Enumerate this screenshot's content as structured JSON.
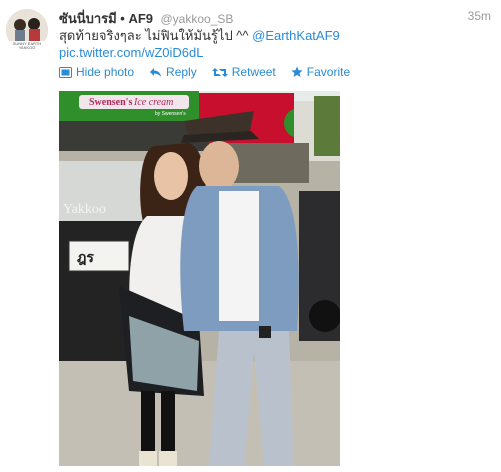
{
  "tweet": {
    "fullname": "ซันนี่บารมี • AF9",
    "username": "@yakkoo_SB",
    "time": "35m",
    "text_main": "สุดท้ายจริงๆละ ไม่ฟินให้มันรู้ไป ^^ ",
    "mention": "@EarthKatAF9",
    "link": "pic.twitter.com/wZ0iD6dL",
    "actions": {
      "hide_photo": "Hide photo",
      "reply": "Reply",
      "retweet": "Retweet",
      "favorite": "Favorite"
    }
  },
  "avatar_text": {
    "line1": "SUNNY EARTH",
    "line2": "YAKKOO"
  },
  "photo_text": {
    "sign_brand": "Swensen's",
    "sign_main": "Ice cream",
    "sign_sub": "by Swensen's",
    "watermark": "Yakkoo",
    "plate": "ฎร"
  },
  "colors": {
    "link": "#2a8bd6",
    "muted": "#999999",
    "sign_green": "#2f8f2a",
    "sign_red": "#c8102e"
  }
}
